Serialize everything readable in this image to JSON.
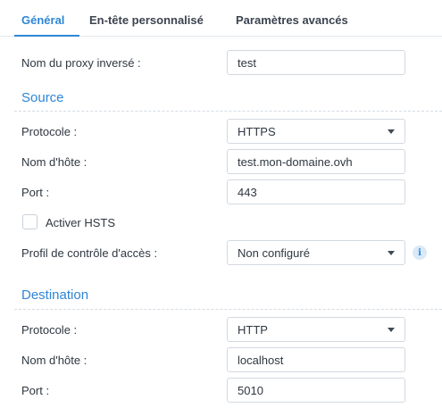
{
  "tabs": [
    {
      "label": "Général",
      "active": true
    },
    {
      "label": "En-tête personnalisé",
      "active": false
    },
    {
      "label": "Paramètres avancés",
      "active": false
    }
  ],
  "proxy_name": {
    "label": "Nom du proxy inversé :",
    "value": "test"
  },
  "source": {
    "heading": "Source",
    "protocol": {
      "label": "Protocole :",
      "value": "HTTPS"
    },
    "hostname": {
      "label": "Nom d'hôte :",
      "value": "test.mon-domaine.ovh"
    },
    "port": {
      "label": "Port :",
      "value": "443"
    },
    "hsts": {
      "label": "Activer HSTS",
      "checked": false
    },
    "access_profile": {
      "label": "Profil de contrôle d'accès :",
      "value": "Non configuré"
    }
  },
  "destination": {
    "heading": "Destination",
    "protocol": {
      "label": "Protocole :",
      "value": "HTTP"
    },
    "hostname": {
      "label": "Nom d'hôte :",
      "value": "localhost"
    },
    "port": {
      "label": "Port :",
      "value": "5010"
    }
  },
  "info_icon_glyph": "i",
  "colors": {
    "accent": "#2f86d6",
    "text": "#2f3741",
    "border": "#d3d9e0"
  }
}
